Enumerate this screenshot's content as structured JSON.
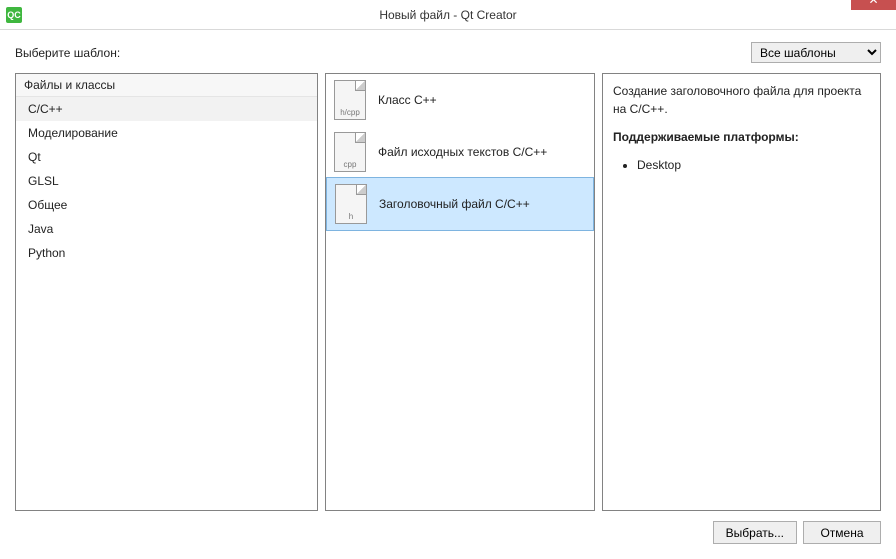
{
  "window": {
    "title": "Новый файл - Qt Creator",
    "app_icon_text": "QC"
  },
  "toprow": {
    "label": "Выберите шаблон:",
    "filter_selected": "Все шаблоны"
  },
  "categories": {
    "header": "Файлы и классы",
    "items": [
      {
        "label": "C/C++",
        "selected": true
      },
      {
        "label": "Моделирование",
        "selected": false
      },
      {
        "label": "Qt",
        "selected": false
      },
      {
        "label": "GLSL",
        "selected": false
      },
      {
        "label": "Общее",
        "selected": false
      },
      {
        "label": "Java",
        "selected": false
      },
      {
        "label": "Python",
        "selected": false
      }
    ]
  },
  "templates": {
    "items": [
      {
        "label": "Класс C++",
        "ext": "h/cpp",
        "selected": false
      },
      {
        "label": "Файл исходных текстов C/C++",
        "ext": "cpp",
        "selected": false
      },
      {
        "label": "Заголовочный файл C/C++",
        "ext": "h",
        "selected": true
      }
    ]
  },
  "description": {
    "text": "Создание заголовочного файла для проекта на C/C++.",
    "platforms_label": "Поддерживаемые платформы:",
    "platforms": [
      "Desktop"
    ]
  },
  "footer": {
    "choose": "Выбрать...",
    "cancel": "Отмена"
  }
}
